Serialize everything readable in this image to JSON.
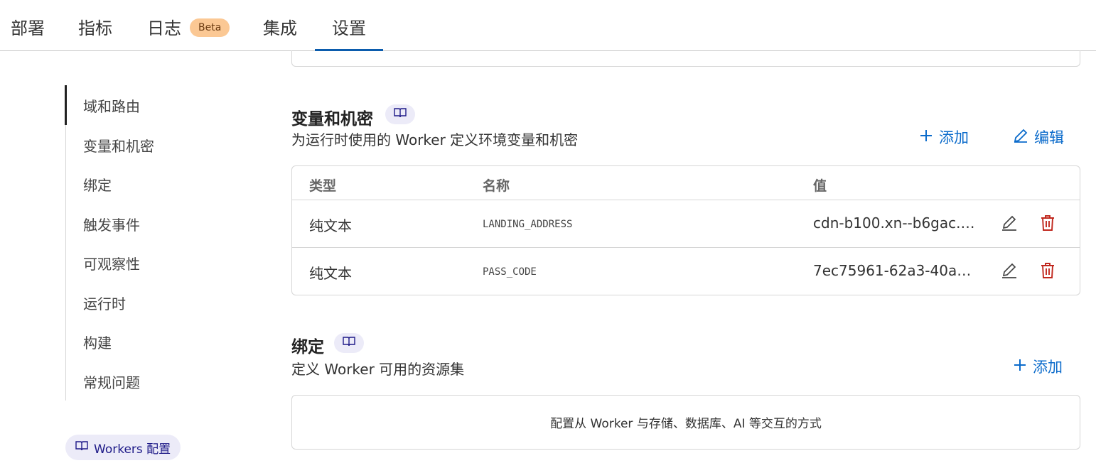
{
  "tabs": [
    {
      "label": "部署"
    },
    {
      "label": "指标"
    },
    {
      "label": "日志",
      "badge": "Beta"
    },
    {
      "label": "集成"
    },
    {
      "label": "设置"
    }
  ],
  "active_tab": "设置",
  "sidebar": {
    "items": [
      {
        "label": "域和路由"
      },
      {
        "label": "变量和机密"
      },
      {
        "label": "绑定"
      },
      {
        "label": "触发事件"
      },
      {
        "label": "可观察性"
      },
      {
        "label": "运行时"
      },
      {
        "label": "构建"
      },
      {
        "label": "常规问题"
      }
    ],
    "active_item": "域和路由",
    "doc_link": "Workers 配置"
  },
  "variables": {
    "title": "变量和机密",
    "description": "为运行时使用的 Worker 定义环境变量和机密",
    "add_label": "添加",
    "edit_label": "编辑",
    "columns": [
      "类型",
      "名称",
      "值"
    ],
    "rows": [
      {
        "type": "纯文本",
        "name": "LANDING_ADDRESS",
        "value": "cdn-b100.xn--b6gac.…"
      },
      {
        "type": "纯文本",
        "name": "PASS_CODE",
        "value": "7ec75961-62a3-40a5…"
      }
    ]
  },
  "bindings": {
    "title": "绑定",
    "description": "定义 Worker 可用的资源集",
    "add_label": "添加",
    "empty_text": "配置从 Worker 与存储、数据库、AI 等交互的方式"
  },
  "colors": {
    "accent": "#0b6bcb",
    "active_tab_underline": "#0b5cad",
    "danger": "#c0271d",
    "badge_bg": "#fbc894",
    "doc_pill_bg": "#ecebf8"
  }
}
